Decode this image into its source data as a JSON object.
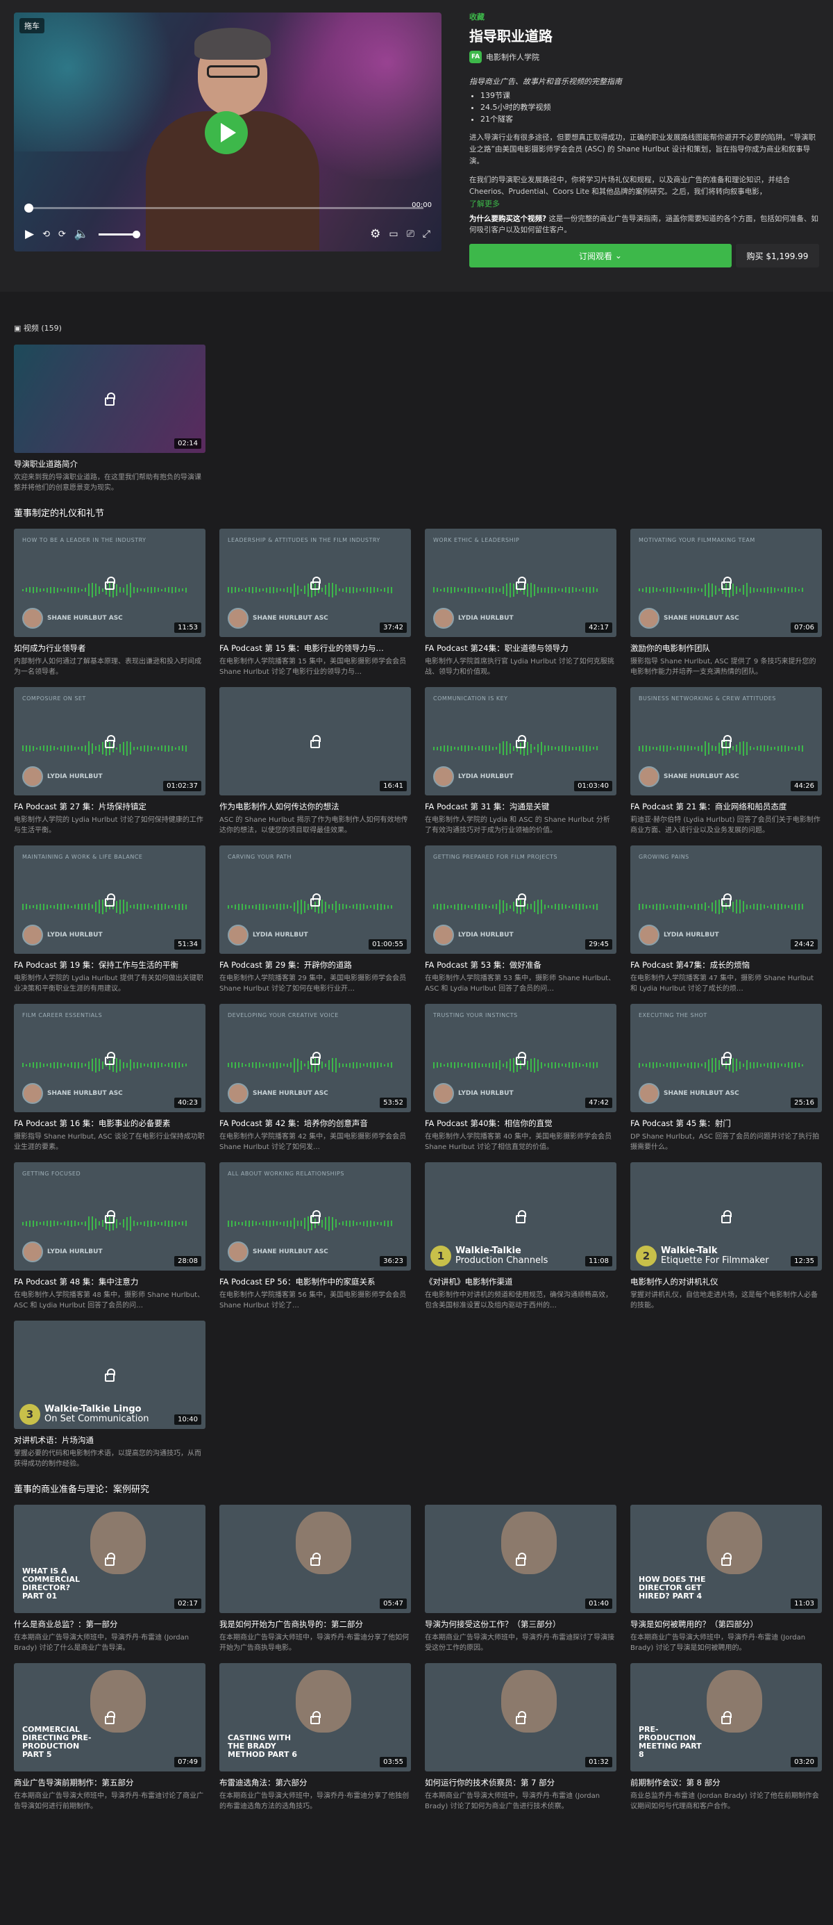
{
  "hero": {
    "badge": "拖车",
    "time": "00:00",
    "tag": "收藏",
    "title": "指导职业道路",
    "org_initials": "FA",
    "org": "电影制作人学院",
    "subtitle": "指导商业广告、故事片和音乐视频的完整指南",
    "bullets": [
      "139节课",
      "24.5小时的教学视频",
      "21个隧客"
    ],
    "p1": "进入导演行业有很多途径，但要想真正取得成功，正确的职业发展路线图能帮你避开不必要的陷阱。“导演职业之路”由美国电影摄影师学会会员 (ASC) 的 Shane Hurlbut 设计和策划，旨在指导你成为商业和叙事导演。",
    "p2": "在我们的导演职业发展路径中，你将学习片场礼仪和规程，以及商业广告的准备和理论知识，并结合 Cheerios、Prudential、Coors Lite 和其他品牌的案例研究。之后，我们将转向叙事电影，",
    "more": "了解更多",
    "why_q": "为什么要购买这个视频?",
    "why_a": "这是一份完整的商业广告导演指南，涵盖你需要知道的各个方面，包括如何准备、如何吸引客户以及如何留住客户。",
    "subscribe": "订阅观看",
    "buy": "购买 $1,199.99"
  },
  "count": "视频 (159)",
  "intro": {
    "dur": "02:14",
    "title": "导演职业道路简介",
    "desc": "欢迎来到我的导演职业道路，在这里我们帮助有抱负的导演课整并将他们的创意愿景变为现实。"
  },
  "sec1": "董事制定的礼仪和礼节",
  "sec1_cards": [
    {
      "type": "pod",
      "ep": "HOW TO BE A LEADER IN THE INDUSTRY",
      "host": "SHANE HURLBUT ASC",
      "dur": "11:53",
      "title": "如何成为行业领导者",
      "desc": "内部制作人如何通过了解基本原理、表现出谦逊和投入时间成为一名领导者。"
    },
    {
      "type": "pod",
      "ep": "LEADERSHIP & ATTITUDES IN THE FILM INDUSTRY",
      "host": "SHANE HURLBUT ASC",
      "dur": "37:42",
      "title": "FA Podcast 第 15 集：电影行业的领导力与…",
      "desc": "在电影制作人学院播客第 15 集中，美国电影摄影师学会会员 Shane Hurlbut 讨论了电影行业的领导力与…"
    },
    {
      "type": "pod",
      "ep": "WORK ETHIC & LEADERSHIP",
      "host": "LYDIA HURLBUT",
      "dur": "42:17",
      "title": "FA Podcast 第24集：职业道德与领导力",
      "desc": "电影制作人学院首席执行官 Lydia Hurlbut 讨论了如何克服挑战、领导力和价值观。"
    },
    {
      "type": "pod",
      "ep": "MOTIVATING YOUR FILMMAKING TEAM",
      "host": "SHANE HURLBUT ASC",
      "dur": "07:06",
      "title": "激励你的电影制作团队",
      "desc": "摄影指导 Shane Hurlbut, ASC 提供了 9 条技巧来提升您的电影制作能力并培养一支充满热情的团队。"
    },
    {
      "type": "pod",
      "ep": "COMPOSURE ON SET",
      "host": "LYDIA HURLBUT",
      "dur": "01:02:37",
      "title": "FA Podcast 第 27 集：片场保持镇定",
      "desc": "电影制作人学院的 Lydia Hurlbut 讨论了如何保持健康的工作与生活平衡。"
    },
    {
      "type": "photo",
      "dur": "16:41",
      "title": "作为电影制作人如何传达你的想法",
      "desc": "ASC 的 Shane Hurlbut 揭示了作为电影制作人如何有效地传达你的想法，以使您的项目取得最佳效果。"
    },
    {
      "type": "pod",
      "ep": "COMMUNICATION IS KEY",
      "host": "LYDIA HURLBUT",
      "dur": "01:03:40",
      "title": "FA Podcast 第 31 集：沟通是关键",
      "desc": "在电影制作人学院的 Lydia 和 ASC 的 Shane Hurlbut 分析了有效沟通技巧对于成为行业领袖的价值。"
    },
    {
      "type": "pod",
      "ep": "BUSINESS NETWORKING & CREW ATTITUDES",
      "host": "SHANE HURLBUT ASC",
      "dur": "44:26",
      "title": "FA Podcast 第 21 集：商业网络和船员态度",
      "desc": "莉迪亚·赫尔伯特 (Lydia Hurlbut) 回答了会员们关于电影制作商业方面、进入该行业以及业务发展的问题。"
    },
    {
      "type": "pod",
      "ep": "MAINTAINING A WORK & LIFE BALANCE",
      "host": "LYDIA HURLBUT",
      "dur": "51:34",
      "title": "FA Podcast 第 19 集：保持工作与生活的平衡",
      "desc": "电影制作人学院的 Lydia Hurlbut 提供了有关如何做出关键职业决策和平衡职业生涯的有用建议。"
    },
    {
      "type": "pod",
      "ep": "CARVING YOUR PATH",
      "host": "LYDIA HURLBUT",
      "dur": "01:00:55",
      "title": "FA Podcast 第 29 集：开辟你的道路",
      "desc": "在电影制作人学院播客第 29 集中，美国电影摄影师学会会员 Shane Hurlbut 讨论了如何在电影行业开…"
    },
    {
      "type": "pod",
      "ep": "GETTING PREPARED FOR FILM PROJECTS",
      "host": "LYDIA HURLBUT",
      "dur": "29:45",
      "title": "FA Podcast 第 53 集：做好准备",
      "desc": "在电影制作人学院播客第 53 集中，摄影师 Shane Hurlbut、ASC 和 Lydia Hurlbut 回答了会员的问…"
    },
    {
      "type": "pod",
      "ep": "GROWING PAINS",
      "host": "LYDIA HURLBUT",
      "dur": "24:42",
      "title": "FA Podcast 第47集：成长的烦恼",
      "desc": "在电影制作人学院播客第 47 集中，摄影师 Shane Hurlbut 和 Lydia Hurlbut 讨论了成长的烦…"
    },
    {
      "type": "pod",
      "ep": "FILM CAREER ESSENTIALS",
      "host": "SHANE HURLBUT ASC",
      "dur": "40:23",
      "title": "FA Podcast 第 16 集：电影事业的必备要素",
      "desc": "摄影指导 Shane Hurlbut, ASC 谈论了在电影行业保持成功职业生涯的要素。"
    },
    {
      "type": "pod",
      "ep": "DEVELOPING YOUR CREATIVE VOICE",
      "host": "SHANE HURLBUT ASC",
      "dur": "53:52",
      "title": "FA Podcast 第 42 集：培养你的创意声音",
      "desc": "在电影制作人学院播客第 42 集中，美国电影摄影师学会会员 Shane Hurlbut 讨论了如何发…"
    },
    {
      "type": "pod",
      "ep": "TRUSTING YOUR INSTINCTS",
      "host": "LYDIA HURLBUT",
      "dur": "47:42",
      "title": "FA Podcast 第40集：相信你的直觉",
      "desc": "在电影制作人学院播客第 40 集中，美国电影摄影师学会会员 Shane Hurlbut 讨论了相信直觉的价值。"
    },
    {
      "type": "pod",
      "ep": "EXECUTING THE SHOT",
      "host": "SHANE HURLBUT ASC",
      "dur": "25:16",
      "title": "FA Podcast 第 45 集：射门",
      "desc": "DP Shane Hurlbut，ASC 回答了会员的问题并讨论了执行拍摄需要什么。"
    },
    {
      "type": "pod",
      "ep": "GETTING FOCUSED",
      "host": "LYDIA HURLBUT",
      "dur": "28:08",
      "title": "FA Podcast 第 48 集：集中注意力",
      "desc": "在电影制作人学院播客第 48 集中，摄影师 Shane Hurlbut、ASC 和 Lydia Hurlbut 回答了会员的问…"
    },
    {
      "type": "pod",
      "ep": "ALL ABOUT WORKING RELATIONSHIPS",
      "host": "SHANE HURLBUT ASC",
      "dur": "36:23",
      "title": "FA Podcast EP 56：电影制作中的家庭关系",
      "desc": "在电影制作人学院播客第 56 集中，美国电影摄影师学会会员 Shane Hurlbut 讨论了…"
    },
    {
      "type": "wt",
      "num": "1",
      "l1": "Walkie-Talkie",
      "l2": "Production Channels",
      "dur": "11:08",
      "title": "《对讲机》电影制作渠道",
      "desc": "在电影制作中对讲机的频道和使用规范，确保沟通顺畅高效，包含美国标准设置以及组内驱动于西州的…"
    },
    {
      "type": "wt",
      "num": "2",
      "l1": "Walkie-Talk",
      "l2": "Etiquette For Filmmaker",
      "dur": "12:35",
      "title": "电影制作人的对讲机礼仪",
      "desc": "掌握对讲机礼仪，自信地走进片场，这是每个电影制作人必备的技能。"
    },
    {
      "type": "wt",
      "num": "3",
      "l1": "Walkie-Talkie Lingo",
      "l2": "On Set Communication",
      "dur": "10:40",
      "title": "对讲机术语：片场沟通",
      "desc": "掌握必要的代码和电影制作术语，以提高您的沟通技巧，从而获得成功的制作经验。"
    }
  ],
  "sec2": "董事的商业准备与理论：案例研究",
  "sec2_cards": [
    {
      "type": "com",
      "ct": "WHAT IS A COMMERCIAL DIRECTOR? PART 01",
      "dur": "02:17",
      "title": "什么是商业总监？：第一部分",
      "desc": "在本期商业广告导演大师班中，导演乔丹·布雷迪 (Jordan Brady) 讨论了什么是商业广告导演。"
    },
    {
      "type": "com",
      "ct": "",
      "dur": "05:47",
      "title": "我是如何开始为广告商执导的：第二部分",
      "desc": "在本期商业广告导演大师班中，导演乔丹·布雷迪分享了他如何开始为广告商执导电影。"
    },
    {
      "type": "com",
      "ct": "",
      "dur": "01:40",
      "title": "导演为何接受这份工作？（第三部分）",
      "desc": "在本期商业广告导演大师班中，导演乔丹·布雷迪探讨了导演接受这份工作的原因。"
    },
    {
      "type": "com",
      "ct": "HOW DOES THE DIRECTOR GET HIRED? PART 4",
      "dur": "11:03",
      "title": "导演是如何被聘用的？（第四部分）",
      "desc": "在本期商业广告导演大师班中，导演乔丹·布雷迪 (Jordan Brady) 讨论了导演是如何被聘用的。"
    },
    {
      "type": "com",
      "ct": "COMMERCIAL DIRECTING PRE-PRODUCTION PART 5",
      "dur": "07:49",
      "title": "商业广告导演前期制作：第五部分",
      "desc": "在本期商业广告导演大师班中，导演乔丹·布雷迪讨论了商业广告导演如何进行前期制作。"
    },
    {
      "type": "com",
      "ct": "CASTING WITH THE BRADY METHOD PART 6",
      "dur": "03:55",
      "title": "布雷迪选角法：第六部分",
      "desc": "在本期商业广告导演大师班中，导演乔丹·布雷迪分享了他独创的布雷迪选角方法的选角技巧。"
    },
    {
      "type": "com",
      "ct": "",
      "dur": "01:32",
      "title": "如何运行你的技术侦察员：第 7 部分",
      "desc": "在本期商业广告导演大师班中，导演乔丹·布雷迪 (Jordan Brady) 讨论了如何为商业广告进行技术侦察。"
    },
    {
      "type": "com",
      "ct": "PRE-PRODUCTION MEETING PART 8",
      "dur": "03:20",
      "title": "前期制作会议：第 8 部分",
      "desc": "商业总监乔丹·布雷迪 (Jordan Brady) 讨论了他在前期制作会议期间如何与代理商和客户合作。"
    }
  ]
}
